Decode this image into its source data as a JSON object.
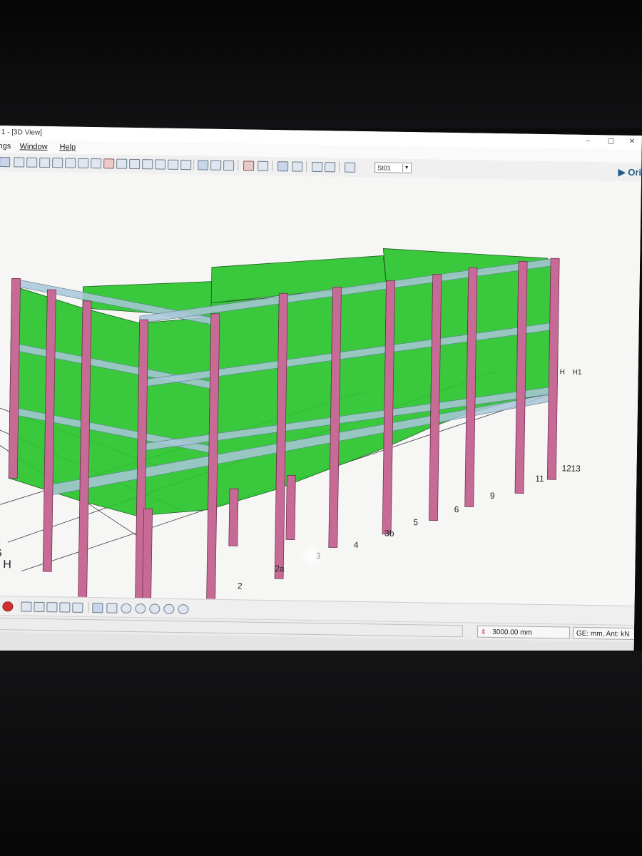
{
  "window": {
    "title": "1 - [3D View]",
    "controls": [
      "–",
      "▢",
      "✕"
    ]
  },
  "menu": {
    "items": [
      "ngs",
      "Window",
      "Help"
    ]
  },
  "toolbar": {
    "story_selector": {
      "value": "St01",
      "icon": "chevron-down-icon"
    },
    "orient_label": "▶ Ori"
  },
  "viewport": {
    "axis_labels": [
      "1",
      "2",
      "2a",
      "3",
      "3b",
      "4",
      "5",
      "6",
      "9",
      "11",
      "12",
      "13"
    ],
    "axis_labels_positions_note": "",
    "grid_letters": [
      "G",
      "H"
    ],
    "right_labels": [
      "H",
      "H1"
    ],
    "colors": {
      "wall": "#29c42c",
      "column": "#c76b96",
      "slab": "#a9c7d8",
      "background": "#f6f6f4"
    }
  },
  "status": {
    "elevation_icon": "z-elevation-icon",
    "elevation": "3000.00 mm",
    "units": "GE: mm, Ant: kN"
  }
}
